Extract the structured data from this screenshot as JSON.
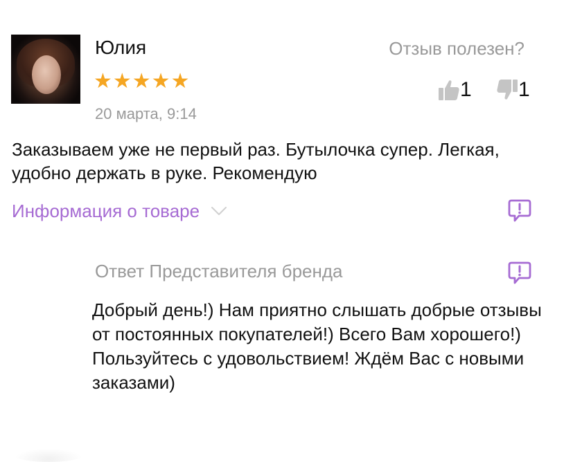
{
  "review": {
    "author": "Юлия",
    "rating": 5,
    "stars": "★★★★★",
    "date": "20 марта, 9:14",
    "text": "Заказываем уже не первый раз. Бутылочка супер. Легкая, удобно держать в руке. Рекомендую"
  },
  "helpful": {
    "label": "Отзыв полезен?",
    "likes": "1",
    "dislikes": "1"
  },
  "product_info": {
    "label": "Информация о товаре"
  },
  "brand_reply": {
    "title": "Ответ Представителя бренда",
    "text": "Добрый день!) Нам приятно слышать добрые отзывы от постоянных покупателей!) Всего Вам хорошего!) Пользуйтесь с удовольствием! Ждём Вас с новыми заказами)"
  },
  "icons": {
    "like": "thumbs-up-icon",
    "dislike": "thumbs-down-icon",
    "chevron": "chevron-down-icon",
    "report": "report-message-icon"
  },
  "colors": {
    "star": "#f5a623",
    "accent": "#a66bd3",
    "muted": "#999999",
    "thumb": "#c4c4c4"
  }
}
